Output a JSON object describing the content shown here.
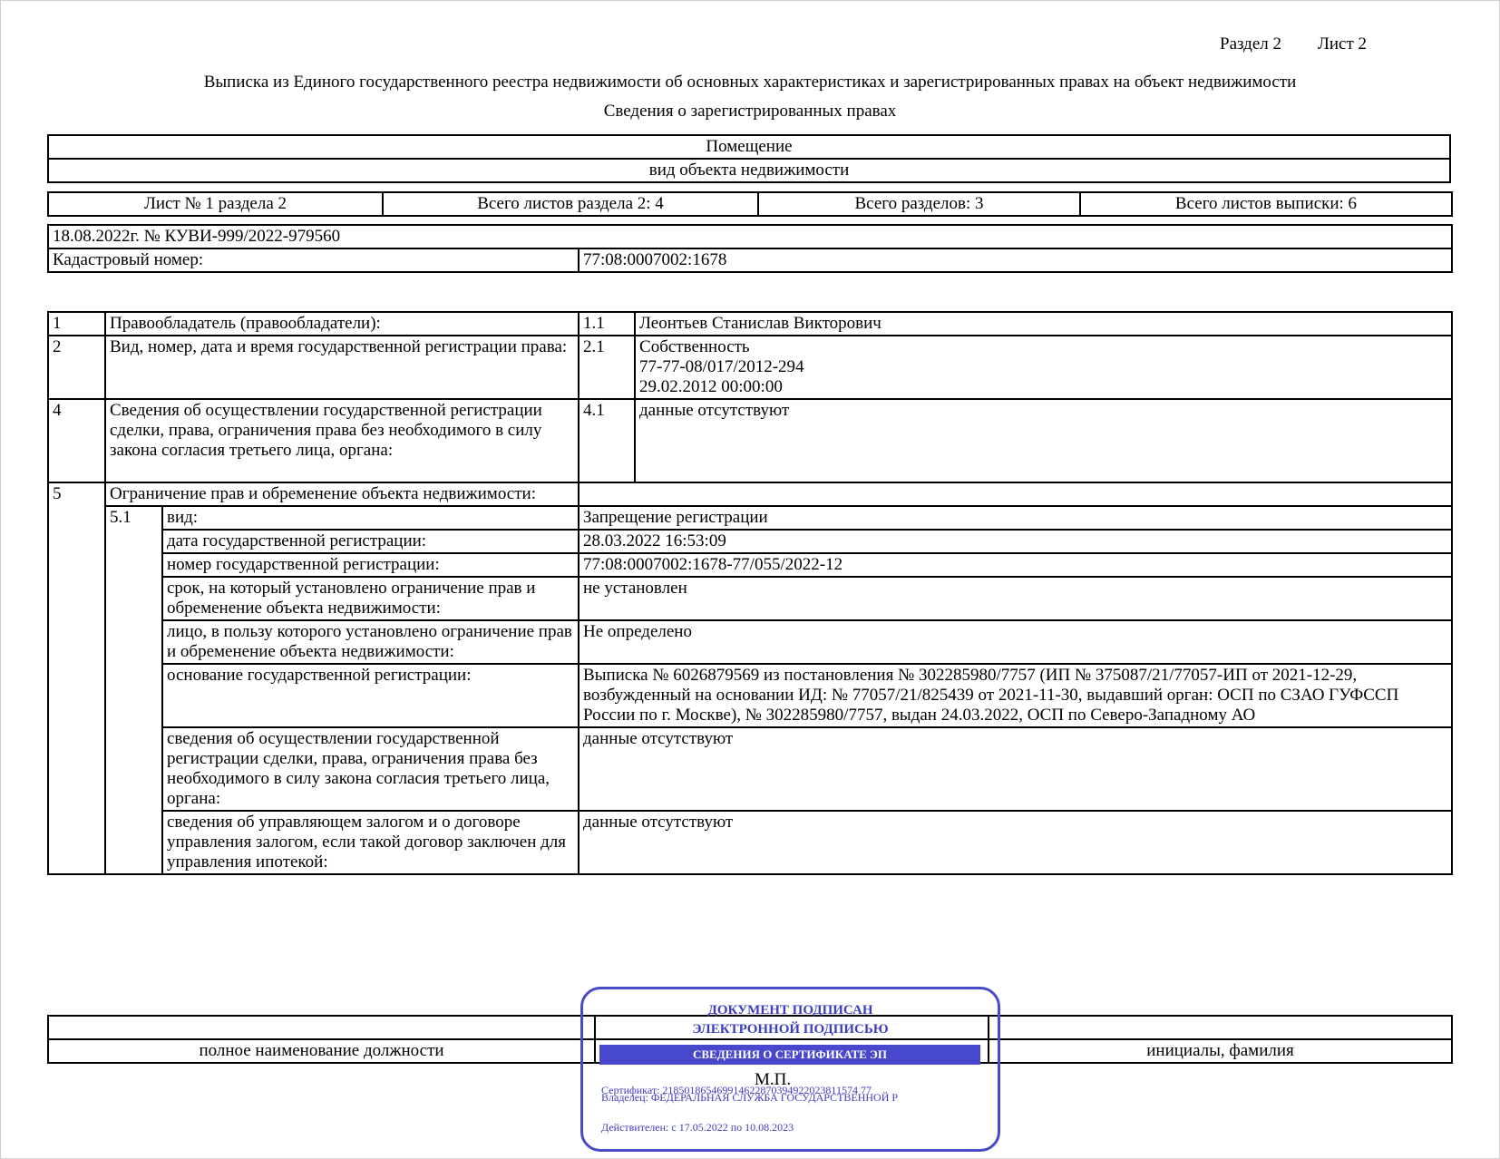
{
  "header": {
    "section": "Раздел 2",
    "sheet": "Лист 2",
    "title": "Выписка из Единого государственного реестра недвижимости об основных характеристиках и зарегистрированных правах на объект недвижимости",
    "subtitle": "Сведения о зарегистрированных правах"
  },
  "object": {
    "name": "Помещение",
    "kind_label": "вид объекта недвижимости"
  },
  "sheets": {
    "sheet_no": "Лист № 1 раздела 2",
    "section_sheets": "Всего листов раздела 2: 4",
    "sections": "Всего разделов: 3",
    "total_sheets": "Всего листов выписки: 6"
  },
  "doc": {
    "date_number": "18.08.2022г. № КУВИ-999/2022-979560",
    "cadastral_label": "Кадастровый номер:",
    "cadastral_value": "77:08:0007002:1678"
  },
  "rows": {
    "r1": {
      "num": "1",
      "label": "Правообладатель (правообладатели):",
      "sub": "1.1",
      "value": "Леонтьев Станислав Викторович"
    },
    "r2": {
      "num": "2",
      "label": "Вид, номер, дата и время государственной регистрации права:",
      "sub": "2.1",
      "value_1": "Собственность",
      "value_2": "77-77-08/017/2012-294",
      "value_3": "29.02.2012 00:00:00"
    },
    "r4": {
      "num": "4",
      "label": "Сведения об осуществлении государственной регистрации сделки, права, ограничения права без необходимого в силу закона согласия третьего лица, органа:",
      "sub": "4.1",
      "value": "данные отсутствуют"
    },
    "r5": {
      "num": "5",
      "label": "Ограничение прав и обременение объекта недвижимости:",
      "sub": "5.1"
    }
  },
  "restriction": [
    {
      "label": "вид:",
      "value": "Запрещение регистрации"
    },
    {
      "label": "дата государственной регистрации:",
      "value": "28.03.2022 16:53:09"
    },
    {
      "label": "номер государственной регистрации:",
      "value": "77:08:0007002:1678-77/055/2022-12"
    },
    {
      "label": "срок, на который установлено ограничение прав и обременение объекта недвижимости:",
      "value": "не установлен"
    },
    {
      "label": "лицо, в пользу которого установлено ограничение прав и обременение объекта недвижимости:",
      "value": "Не определено"
    },
    {
      "label": "основание государственной регистрации:",
      "value": "Выписка № 6026879569 из постановления № 302285980/7757 (ИП № 375087/21/77057-ИП от 2021-12-29, возбужденный на основании ИД: № 77057/21/825439 от 2021-11-30, выдавший орган: ОСП по СЗАО ГУФССП России по г. Москве), № 302285980/7757, выдан 24.03.2022, ОСП по Северо-Западному АО"
    },
    {
      "label": "сведения об осуществлении государственной регистрации сделки, права, ограничения права без необходимого в силу закона согласия третьего лица, органа:",
      "value": "данные отсутствуют"
    },
    {
      "label": "сведения об управляющем залогом и о договоре управления залогом, если такой договор заключен для управления ипотекой:",
      "value": "данные отсутствуют"
    }
  ],
  "signature": {
    "position_label": "полное наименование должности",
    "initials_label": "инициалы, фамилия",
    "mp": "М.П."
  },
  "stamp": {
    "line1": "ДОКУМЕНТ ПОДПИСАН",
    "line2": "ЭЛЕКТРОННОЙ ПОДПИСЬЮ",
    "bar": "СВЕДЕНИЯ О СЕРТИФИКАТЕ ЭП",
    "certificate": "Сертификат: 218501865469914622870394922023811574 77",
    "owner": "Владелец: ФЕДЕРАЛЬНАЯ СЛУЖБА ГОСУДАРСТВЕННОЙ Р",
    "valid": "Действителен: с 17.05.2022 по 10.08.2023"
  }
}
